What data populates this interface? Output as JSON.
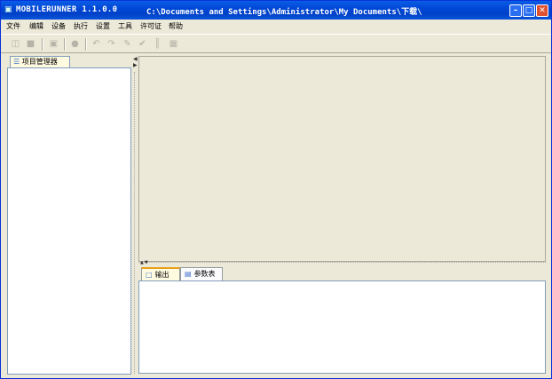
{
  "window": {
    "app_title": "MOBILERUNNER 1.1.0.0",
    "path": "C:\\Documents and Settings\\Administrator\\My Documents\\下载\\"
  },
  "menu": [
    "文件",
    "编辑",
    "设备",
    "执行",
    "设置",
    "工具",
    "许可证",
    "帮助"
  ],
  "left_panel": {
    "tab_label": "项目管理器"
  },
  "bottom_panel": {
    "tabs": [
      "输出",
      "参数表"
    ]
  },
  "icons": {
    "app": "mobile-icon",
    "toolbar": [
      "new-file-icon",
      "stop-icon",
      "step-icon",
      "record-icon",
      "undo-icon",
      "redo-icon",
      "edit-icon",
      "checkpoint-icon",
      "split-icon",
      "export-icon"
    ]
  }
}
